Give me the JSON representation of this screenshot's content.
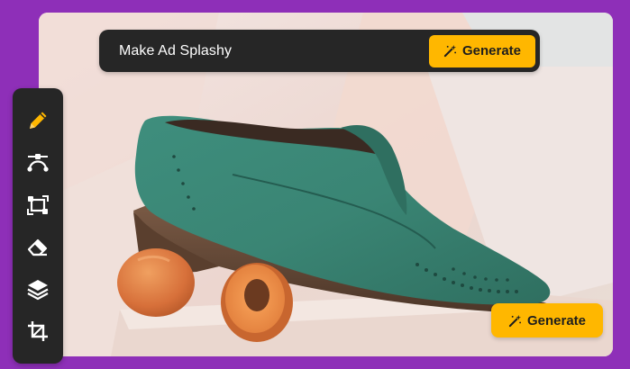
{
  "prompt_bar": {
    "text": "Make Ad Splashy",
    "generate_label": "Generate"
  },
  "floating_generate": {
    "label": "Generate"
  },
  "toolbar": {
    "tools": [
      {
        "icon": "pencil-icon",
        "active": true
      },
      {
        "icon": "bezier-curve-icon",
        "active": false
      },
      {
        "icon": "transform-icon",
        "active": false
      },
      {
        "icon": "eraser-icon",
        "active": false
      },
      {
        "icon": "layers-icon",
        "active": false
      },
      {
        "icon": "crop-icon",
        "active": false
      }
    ]
  },
  "colors": {
    "page_background": "#8e2fb8",
    "panel_background": "#262626",
    "accent": "#ffb700",
    "shoe": "#3f9180",
    "apricot": "#e08040"
  }
}
